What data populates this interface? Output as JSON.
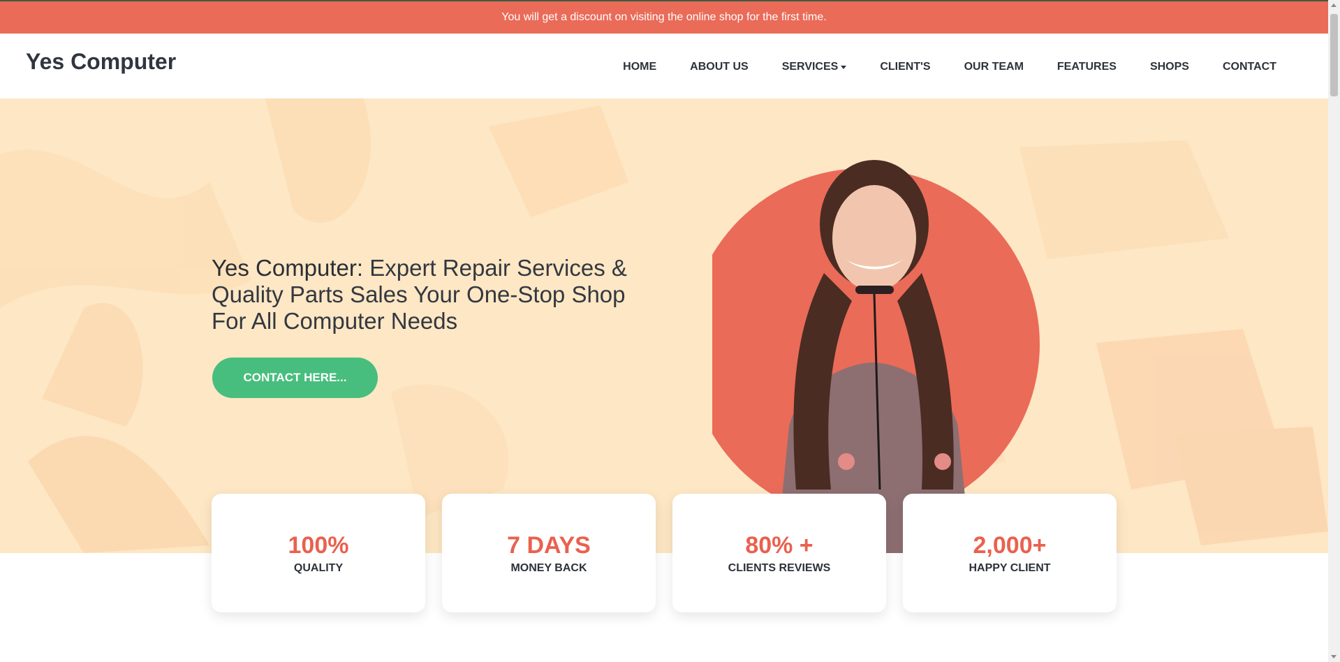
{
  "announcement": {
    "text": "You will get a discount on visiting the online shop for the first time."
  },
  "header": {
    "brand": "Yes Computer",
    "nav": [
      {
        "label": "HOME"
      },
      {
        "label": "ABOUT US"
      },
      {
        "label": "SERVICES",
        "dropdown": true
      },
      {
        "label": "CLIENT'S"
      },
      {
        "label": "OUR TEAM"
      },
      {
        "label": "FEATURES"
      },
      {
        "label": "SHOPS"
      },
      {
        "label": "CONTACT"
      }
    ]
  },
  "hero": {
    "headline_strong": "Yes Computer:",
    "headline_rest": " Expert Repair Services & Quality Parts Sales Your One-Stop Shop For All Computer Needs",
    "cta_label": "CONTACT HERE...",
    "image_icon": "portrait-photo"
  },
  "stats": [
    {
      "value": "100%",
      "label": "QUALITY"
    },
    {
      "value": "7 DAYS",
      "label": "MONEY BACK"
    },
    {
      "value": "80% +",
      "label": "CLIENTS REVIEWS"
    },
    {
      "value": "2,000+",
      "label": "HAPPY CLIENT"
    }
  ],
  "colors": {
    "accent": "#ea6b58",
    "cta": "#47be7d",
    "hero_bg": "#fde7c4",
    "stat_value": "#e9614f"
  }
}
